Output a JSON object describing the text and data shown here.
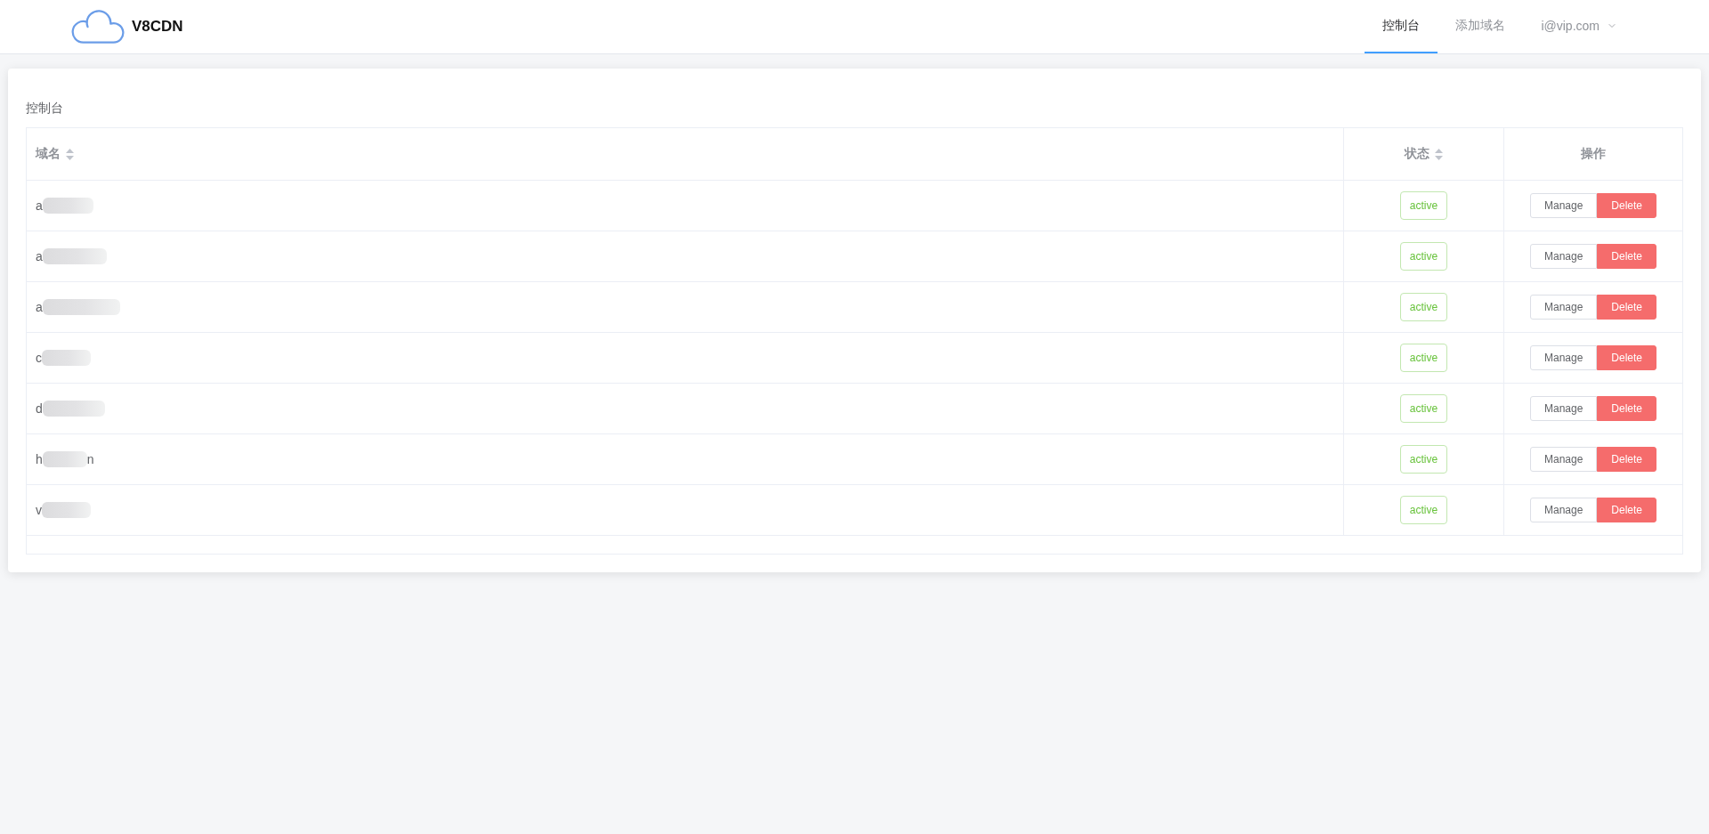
{
  "header": {
    "logo_text": "V8CDN",
    "nav": [
      {
        "label": "控制台",
        "selected": true
      },
      {
        "label": "添加域名",
        "selected": false
      }
    ],
    "user_menu": {
      "label": "i@vip.com"
    }
  },
  "card": {
    "title": "控制台"
  },
  "table": {
    "columns": [
      {
        "label": "域名",
        "sortable": true
      },
      {
        "label": "状态",
        "sortable": true
      },
      {
        "label": "操作",
        "sortable": false
      }
    ],
    "rows": [
      {
        "domain": [
          {
            "kind": "text",
            "text": "a"
          },
          {
            "kind": "redacted"
          }
        ],
        "status": "active",
        "actions": [
          {
            "kind": "manage",
            "label": "Manage"
          },
          {
            "kind": "delete",
            "label": "Delete"
          }
        ]
      },
      {
        "domain": [
          {
            "kind": "text",
            "text": "a"
          },
          {
            "kind": "redacted"
          }
        ],
        "status": "active",
        "actions": [
          {
            "kind": "manage",
            "label": "Manage"
          },
          {
            "kind": "delete",
            "label": "Delete"
          }
        ]
      },
      {
        "domain": [
          {
            "kind": "text",
            "text": "a"
          },
          {
            "kind": "redacted"
          }
        ],
        "status": "active",
        "actions": [
          {
            "kind": "manage",
            "label": "Manage"
          },
          {
            "kind": "delete",
            "label": "Delete"
          }
        ]
      },
      {
        "domain": [
          {
            "kind": "text",
            "text": "c"
          },
          {
            "kind": "redacted"
          }
        ],
        "status": "active",
        "actions": [
          {
            "kind": "manage",
            "label": "Manage"
          },
          {
            "kind": "delete",
            "label": "Delete"
          }
        ]
      },
      {
        "domain": [
          {
            "kind": "text",
            "text": "d"
          },
          {
            "kind": "redacted"
          }
        ],
        "status": "active",
        "actions": [
          {
            "kind": "manage",
            "label": "Manage"
          },
          {
            "kind": "delete",
            "label": "Delete"
          }
        ]
      },
      {
        "domain": [
          {
            "kind": "text",
            "text": "h"
          },
          {
            "kind": "redacted"
          },
          {
            "kind": "text",
            "text": "n"
          }
        ],
        "status": "active",
        "actions": [
          {
            "kind": "manage",
            "label": "Manage"
          },
          {
            "kind": "delete",
            "label": "Delete"
          }
        ]
      },
      {
        "domain": [
          {
            "kind": "text",
            "text": "v"
          },
          {
            "kind": "redacted"
          }
        ],
        "status": "active",
        "actions": [
          {
            "kind": "manage",
            "label": "Manage"
          },
          {
            "kind": "delete",
            "label": "Delete"
          }
        ]
      }
    ]
  }
}
